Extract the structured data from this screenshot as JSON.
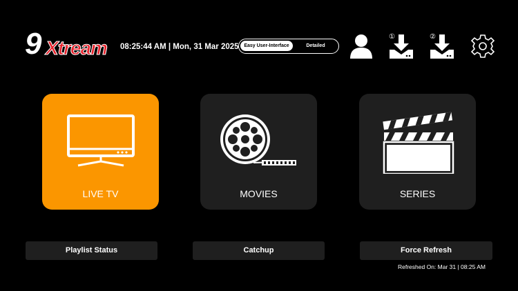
{
  "logo": {
    "part1": "9",
    "part2": "Xtream"
  },
  "header": {
    "datetime": "08:25:44 AM | Mon, 31 Mar 2025",
    "mode_toggle": {
      "selected": "Easy User-Interface",
      "other": "Detailed"
    },
    "download_badge_1": "①",
    "download_badge_2": "②"
  },
  "tiles": [
    {
      "label": "LIVE TV",
      "active": true
    },
    {
      "label": "MOVIES",
      "active": false
    },
    {
      "label": "SERIES",
      "active": false
    }
  ],
  "bottom_buttons": [
    "Playlist Status",
    "Catchup",
    "Force Refresh"
  ],
  "refreshed": "Refreshed On: Mar 31 | 08:25 AM",
  "colors": {
    "accent": "#fb9600",
    "tile_bg": "#1f1f1f",
    "logo_red": "#e8202a"
  },
  "icons": [
    "user-icon",
    "download-icon",
    "download-icon",
    "gear-icon",
    "tv-icon",
    "film-reel-icon",
    "clapperboard-icon"
  ]
}
